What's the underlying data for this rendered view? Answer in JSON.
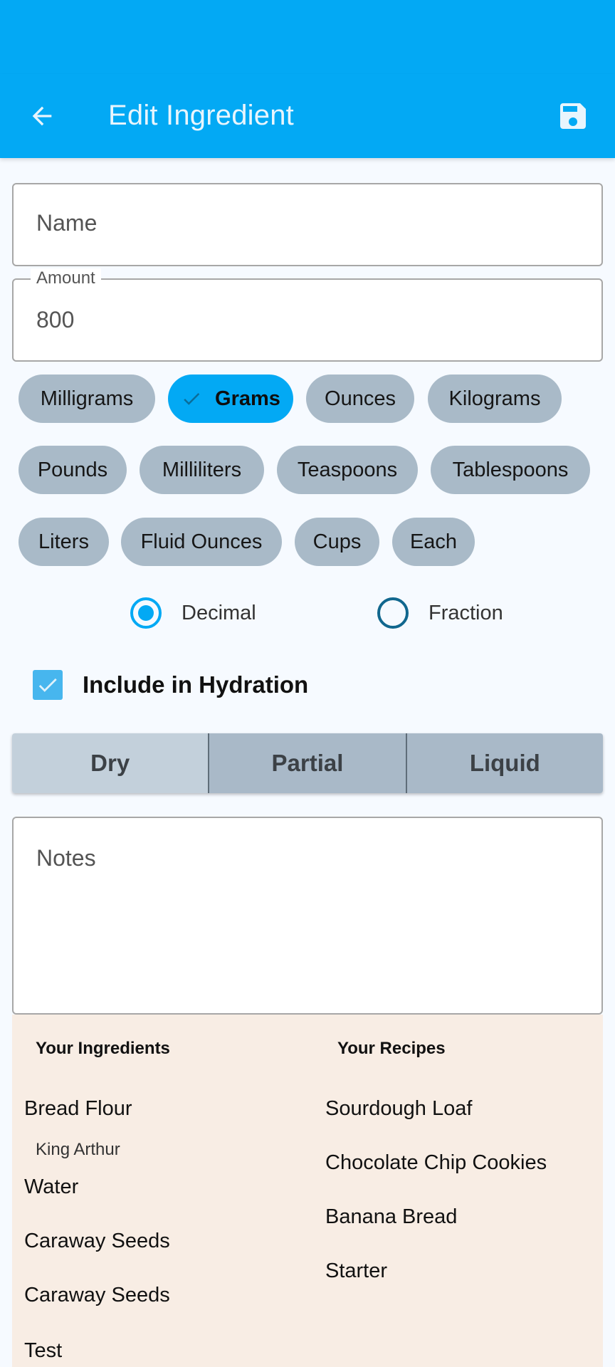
{
  "app_bar": {
    "title": "Edit Ingredient",
    "back_icon": "arrow-back-icon",
    "save_icon": "floppy-disk-icon",
    "color": "#03a9f4"
  },
  "form": {
    "name": {
      "placeholder": "Name",
      "value": ""
    },
    "amount": {
      "label": "Amount",
      "value": "800"
    },
    "notes": {
      "placeholder": "Notes",
      "value": ""
    }
  },
  "units": {
    "selected": "Grams",
    "chips": [
      "Milligrams",
      "Grams",
      "Ounces",
      "Kilograms",
      "Pounds",
      "Milliliters",
      "Teaspoons",
      "Tablespoons",
      "Liters",
      "Fluid Ounces",
      "Cups",
      "Each"
    ]
  },
  "format": {
    "options": [
      "Decimal",
      "Fraction"
    ],
    "selected": "Decimal"
  },
  "hydration": {
    "label": "Include in Hydration",
    "checked": true
  },
  "type_segment": {
    "options": [
      "Dry",
      "Partial",
      "Liquid"
    ],
    "selected": "Dry"
  },
  "ingredients": {
    "heading": "Your Ingredients",
    "items": [
      {
        "name": "Bread Flour",
        "brand": "King Arthur"
      },
      {
        "name": "Water"
      },
      {
        "name": "Caraway Seeds"
      },
      {
        "name": "Caraway Seeds"
      },
      {
        "name": "Test"
      }
    ]
  },
  "recipes": {
    "heading": "Your Recipes",
    "items": [
      "Sourdough Loaf",
      "Chocolate Chip Cookies",
      "Banana Bread",
      "Starter"
    ]
  }
}
